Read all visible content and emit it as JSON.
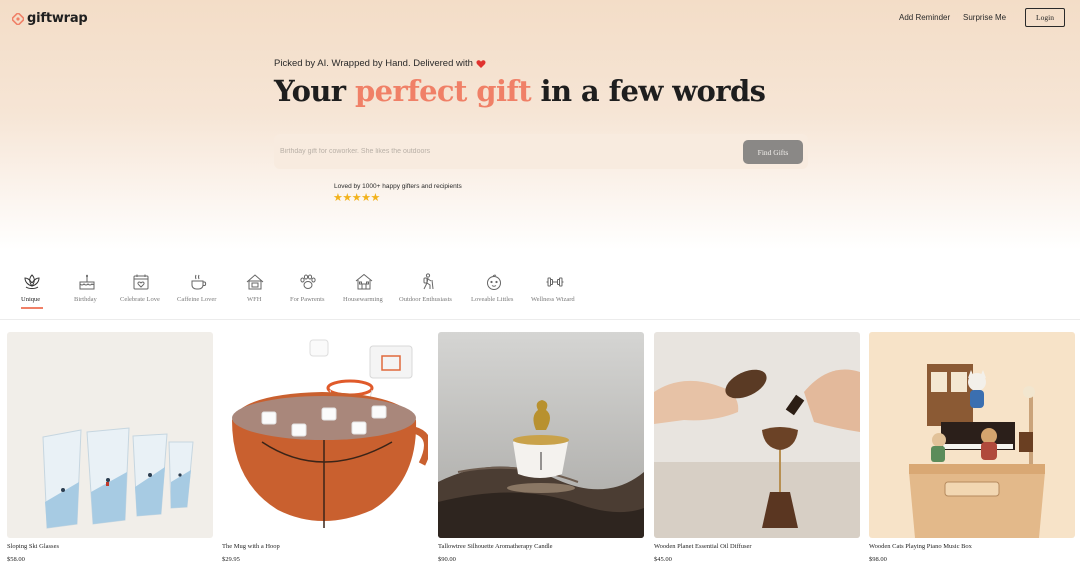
{
  "nav": {
    "logo_text": "giftwrap",
    "links": [
      "Add Reminder",
      "Surprise Me"
    ],
    "login_label": "Login"
  },
  "hero": {
    "tagline": "Picked by AI. Wrapped by Hand. Delivered with",
    "headline_prefix": "Your ",
    "headline_accent": "perfect gift",
    "headline_suffix": " in a few words",
    "search_placeholder": "Birthday gift for coworker. She likes the outdoors",
    "search_value": "",
    "find_button": "Find Gifts",
    "social_proof": "Loved by 1000+ happy gifters and recipients",
    "stars": "★★★★★",
    "rating": 5
  },
  "categories": [
    {
      "label": "Unique",
      "icon": "lotus-icon",
      "active": true
    },
    {
      "label": "Birthday",
      "icon": "cake-icon",
      "active": false
    },
    {
      "label": "Celebrate Love",
      "icon": "calendar-heart-icon",
      "active": false
    },
    {
      "label": "Caffeine Lover",
      "icon": "coffee-cup-icon",
      "active": false
    },
    {
      "label": "WFH",
      "icon": "home-office-icon",
      "active": false
    },
    {
      "label": "For Pawrents",
      "icon": "paw-icon",
      "active": false
    },
    {
      "label": "Housewarming",
      "icon": "house-icon",
      "active": false
    },
    {
      "label": "Outdoor Enthusiasts",
      "icon": "hiker-icon",
      "active": false
    },
    {
      "label": "Loveable Littles",
      "icon": "baby-icon",
      "active": false
    },
    {
      "label": "Wellness Wizard",
      "icon": "dumbbell-icon",
      "active": false
    }
  ],
  "products": [
    {
      "name": "Sloping Ski Glasses",
      "price": "$58.00"
    },
    {
      "name": "The Mug with a Hoop",
      "price": "$29.95"
    },
    {
      "name": "Tallowtree Silhouette Aromatherapy Candle",
      "price": "$90.00"
    },
    {
      "name": "Wooden Planet Essential Oil Diffuser",
      "price": "$45.00"
    },
    {
      "name": "Wooden Cats Playing Piano Music Box",
      "price": "$98.00"
    }
  ],
  "colors": {
    "accent": "#f08067",
    "hero_bg": "#f3ddc7",
    "star": "#f2b21c",
    "button_gray": "#8a8886"
  }
}
